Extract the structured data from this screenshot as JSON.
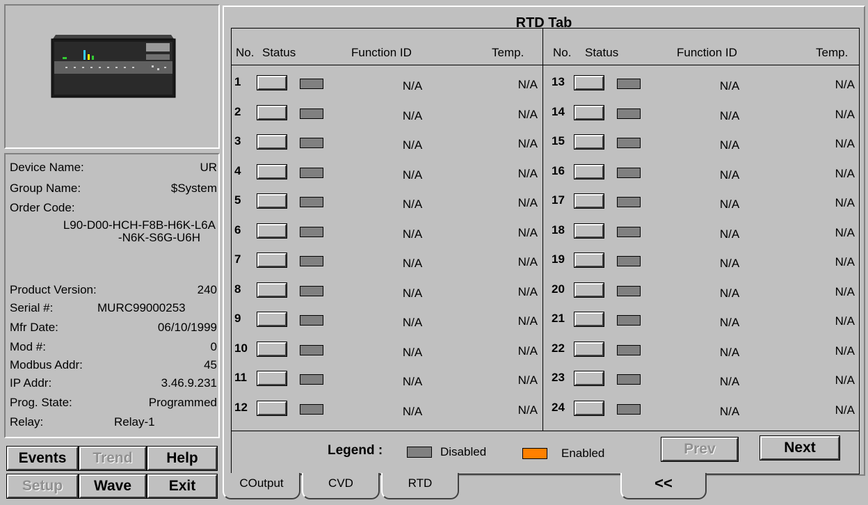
{
  "device": {
    "info": {
      "device_name_label": "Device Name:",
      "device_name": "UR",
      "group_name_label": "Group Name:",
      "group_name": "$System",
      "order_code_label": "Order Code:",
      "order_code_line1": "L90-D00-HCH-F8B-H6K-L6A",
      "order_code_line2": "-N6K-S6G-U6H",
      "product_version_label": "Product Version:",
      "product_version": "240",
      "serial_label": "Serial #:",
      "serial": "MURC99000253",
      "mfr_date_label": "Mfr Date:",
      "mfr_date": "06/10/1999",
      "mod_label": "Mod #:",
      "mod": "0",
      "modbus_label": "Modbus Addr:",
      "modbus": "45",
      "ip_label": "IP Addr:",
      "ip": "3.46.9.231",
      "prog_state_label": "Prog. State:",
      "prog_state": "Programmed",
      "relay_label": "Relay:",
      "relay": "Relay-1"
    }
  },
  "commands": {
    "events": "Events",
    "trend": "Trend",
    "help": "Help",
    "setup": "Setup",
    "wave": "Wave",
    "exit": "Exit"
  },
  "rtd_tab": {
    "title": "RTD Tab",
    "headers": {
      "no": "No.",
      "status": "Status",
      "function_id": "Function ID",
      "temp": "Temp."
    },
    "left_rows": [
      {
        "no": "1",
        "function_id": "N/A",
        "temp": "N/A"
      },
      {
        "no": "2",
        "function_id": "N/A",
        "temp": "N/A"
      },
      {
        "no": "3",
        "function_id": "N/A",
        "temp": "N/A"
      },
      {
        "no": "4",
        "function_id": "N/A",
        "temp": "N/A"
      },
      {
        "no": "5",
        "function_id": "N/A",
        "temp": "N/A"
      },
      {
        "no": "6",
        "function_id": "N/A",
        "temp": "N/A"
      },
      {
        "no": "7",
        "function_id": "N/A",
        "temp": "N/A"
      },
      {
        "no": "8",
        "function_id": "N/A",
        "temp": "N/A"
      },
      {
        "no": "9",
        "function_id": "N/A",
        "temp": "N/A"
      },
      {
        "no": "10",
        "function_id": "N/A",
        "temp": "N/A"
      },
      {
        "no": "11",
        "function_id": "N/A",
        "temp": "N/A"
      },
      {
        "no": "12",
        "function_id": "N/A",
        "temp": "N/A"
      }
    ],
    "right_rows": [
      {
        "no": "13",
        "function_id": "N/A",
        "temp": "N/A"
      },
      {
        "no": "14",
        "function_id": "N/A",
        "temp": "N/A"
      },
      {
        "no": "15",
        "function_id": "N/A",
        "temp": "N/A"
      },
      {
        "no": "16",
        "function_id": "N/A",
        "temp": "N/A"
      },
      {
        "no": "17",
        "function_id": "N/A",
        "temp": "N/A"
      },
      {
        "no": "18",
        "function_id": "N/A",
        "temp": "N/A"
      },
      {
        "no": "19",
        "function_id": "N/A",
        "temp": "N/A"
      },
      {
        "no": "20",
        "function_id": "N/A",
        "temp": "N/A"
      },
      {
        "no": "21",
        "function_id": "N/A",
        "temp": "N/A"
      },
      {
        "no": "22",
        "function_id": "N/A",
        "temp": "N/A"
      },
      {
        "no": "23",
        "function_id": "N/A",
        "temp": "N/A"
      },
      {
        "no": "24",
        "function_id": "N/A",
        "temp": "N/A"
      }
    ],
    "legend": {
      "label": "Legend :",
      "disabled": "Disabled",
      "enabled": "Enabled",
      "disabled_color": "#808080",
      "enabled_color": "#ff8000"
    },
    "prev": "Prev",
    "next": "Next"
  },
  "tabs": [
    "COutput",
    "CVD",
    "RTD"
  ],
  "collapse_label": "<<"
}
